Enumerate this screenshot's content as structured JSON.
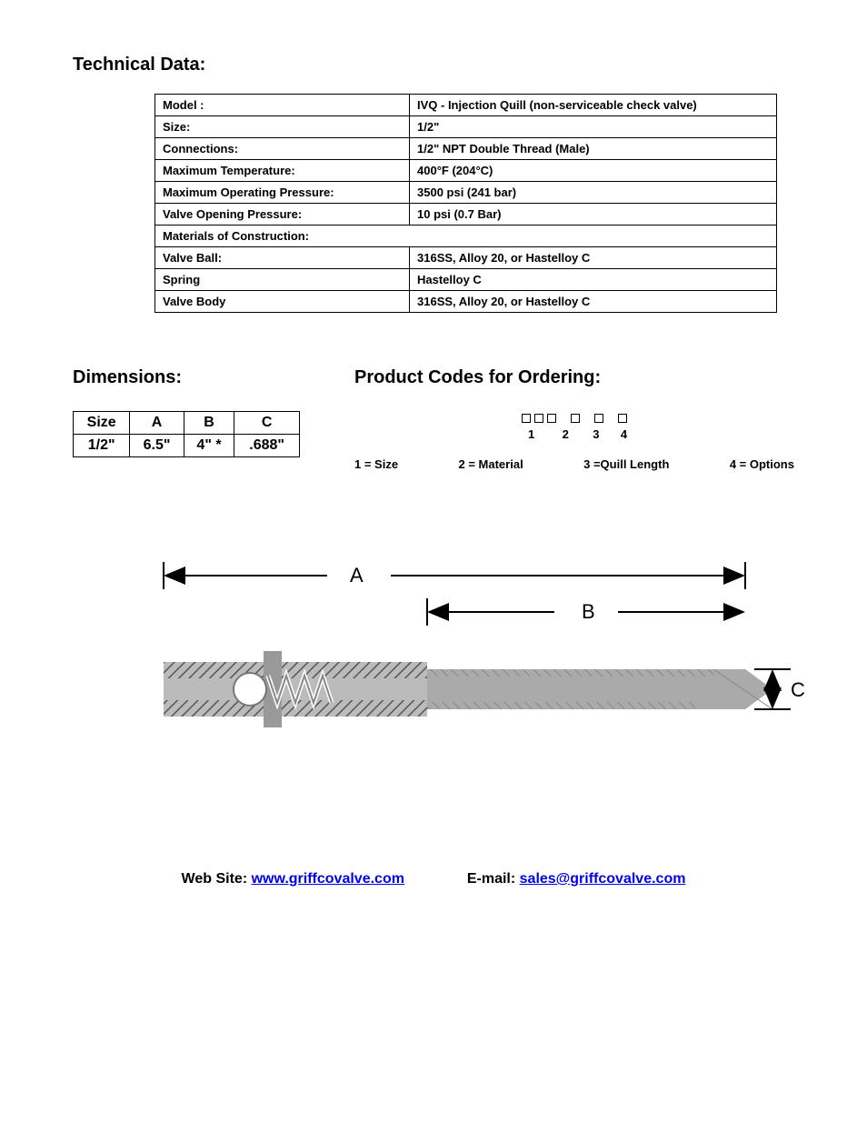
{
  "sections": {
    "technical_title": "Technical Data:",
    "dimensions_title": "Dimensions:",
    "codes_title": "Product Codes for Ordering:"
  },
  "tech_rows": [
    {
      "label": "Model :",
      "value": "IVQ - Injection Quill (non-serviceable check valve)"
    },
    {
      "label": "Size:",
      "value": "1/2\""
    },
    {
      "label": "Connections:",
      "value": "1/2\" NPT Double Thread (Male)"
    },
    {
      "label": "Maximum Temperature:",
      "value": "400°F  (204°C)"
    },
    {
      "label": "Maximum Operating Pressure:",
      "value": "3500 psi  (241 bar)"
    },
    {
      "label": "Valve Opening Pressure:",
      "value": "10 psi (0.7 Bar)"
    },
    {
      "label": "Materials of Construction:",
      "value": ""
    },
    {
      "label": "Valve Ball:",
      "value": "316SS, Alloy 20, or Hastelloy C"
    },
    {
      "label": "Spring",
      "value": "Hastelloy C"
    },
    {
      "label": "Valve Body",
      "value": "316SS, Alloy 20, or Hastelloy C"
    }
  ],
  "dims": {
    "headers": [
      "Size",
      "A",
      "B",
      "C"
    ],
    "row": [
      "1/2\"",
      "6.5\"",
      "4\" *",
      ".688\""
    ]
  },
  "codes": {
    "nums": [
      "1",
      "2",
      "3",
      "4"
    ],
    "legend": [
      "1 = Size",
      "2 = Material",
      "3 =Quill Length",
      "4 = Options"
    ]
  },
  "diagram": {
    "label_a": "A",
    "label_b": "B",
    "label_c": "C"
  },
  "footer": {
    "web_label": "Web Site: ",
    "web_url": "www.griffcovalve.com",
    "email_label": "E-mail: ",
    "email": "sales@griffcovalve.com"
  }
}
